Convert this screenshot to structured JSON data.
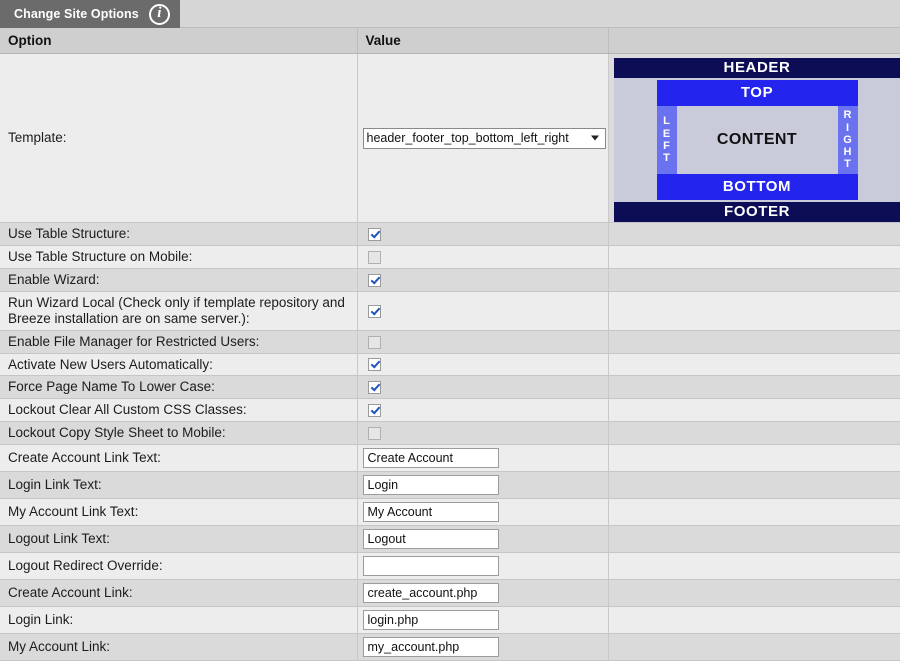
{
  "tab": {
    "label": "Change Site Options",
    "info_icon": "info-icon",
    "icon_glyph": "i"
  },
  "table": {
    "headers": [
      "Option",
      "Value",
      ""
    ],
    "template_row": {
      "label": "Template:",
      "select_value": "header_footer_top_bottom_left_right",
      "select_options": [
        "header_footer_top_bottom_left_right"
      ],
      "dropdown_icon": "chevron-down-icon"
    },
    "template_preview": {
      "header": "HEADER",
      "top": "TOP",
      "left": "LEFT",
      "content": "CONTENT",
      "right": "RIGHT",
      "bottom": "BOTTOM",
      "footer": "FOOTER",
      "colors": {
        "header_footer": "#0d0d56",
        "top_bottom": "#2424ef",
        "sides": "#6b72ef",
        "content": "#c9cbdb"
      }
    },
    "rows": [
      {
        "label": "Use Table Structure:",
        "type": "checkbox",
        "checked": true
      },
      {
        "label": "Use Table Structure on Mobile:",
        "type": "checkbox",
        "checked": false
      },
      {
        "label": "Enable Wizard:",
        "type": "checkbox",
        "checked": true
      },
      {
        "label": "Run Wizard Local (Check only if template repository and Breeze installation are on same server.):",
        "type": "checkbox",
        "checked": true
      },
      {
        "label": "Enable File Manager for Restricted Users:",
        "type": "checkbox",
        "checked": false
      },
      {
        "label": "Activate New Users Automatically:",
        "type": "checkbox",
        "checked": true
      },
      {
        "label": "Force Page Name To Lower Case:",
        "type": "checkbox",
        "checked": true
      },
      {
        "label": "Lockout Clear All Custom CSS Classes:",
        "type": "checkbox",
        "checked": true
      },
      {
        "label": "Lockout Copy Style Sheet to Mobile:",
        "type": "checkbox",
        "checked": false
      },
      {
        "label": "Create Account Link Text:",
        "type": "text",
        "value": "Create Account"
      },
      {
        "label": "Login Link Text:",
        "type": "text",
        "value": "Login"
      },
      {
        "label": "My Account Link Text:",
        "type": "text",
        "value": "My Account"
      },
      {
        "label": "Logout Link Text:",
        "type": "text",
        "value": "Logout"
      },
      {
        "label": "Logout Redirect Override:",
        "type": "text",
        "value": ""
      },
      {
        "label": "Create Account Link:",
        "type": "text",
        "value": "create_account.php"
      },
      {
        "label": "Login Link:",
        "type": "text",
        "value": "login.php"
      },
      {
        "label": "My Account Link:",
        "type": "text",
        "value": "my_account.php"
      }
    ]
  }
}
